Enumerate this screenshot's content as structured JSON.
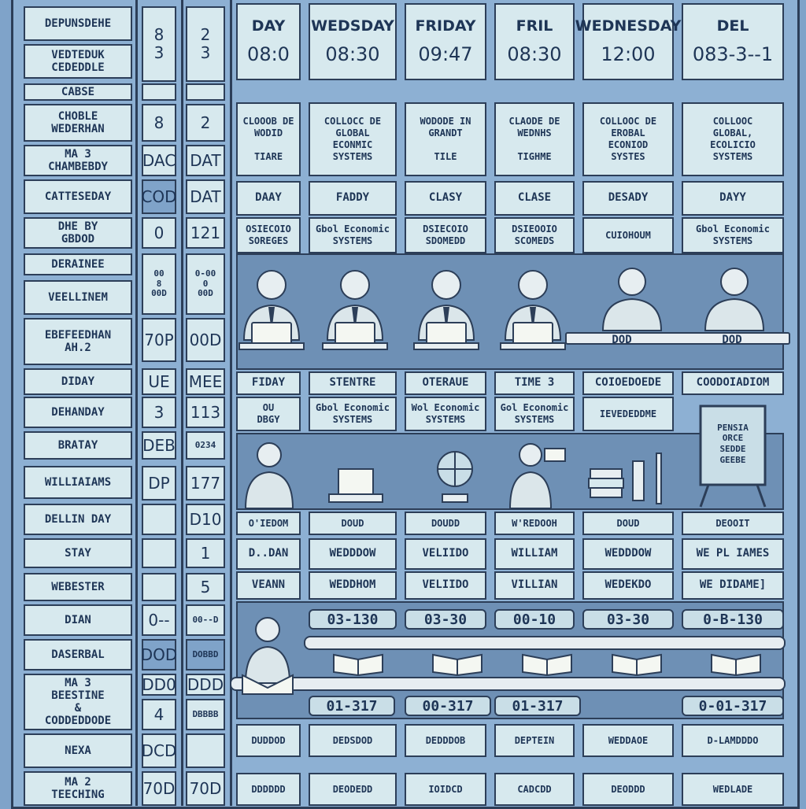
{
  "left_labels": [
    "DEPUNSDEHE",
    "VEDTEDUK\nCEDEDDLE",
    "CABSE",
    "CHOBLE\nWEDERHAN",
    "MA 3\nCHAMBEBDY",
    "CATTESEDAY",
    "DHE BY\nGBDOD",
    "DERAINEE",
    "VEELLINEM",
    "EBEFEEDHAN\nAH.2",
    "DIDAY",
    "DEHANDAY",
    "BRATAY",
    "WILLIAIAMS",
    "DELLIN DAY",
    "STAY",
    "WEBESTER",
    "DIAN",
    "DASERBAL",
    "MA 3\nBEESTINE\n&\nCODDEDDODE",
    "NEXA",
    "MA 2\nTEECHING"
  ],
  "num_col_a": [
    "8\n3",
    "",
    "8",
    "DAC",
    "COD",
    "0",
    "00\n8\n00D",
    "70P",
    "UE",
    "3",
    "DEB",
    "DP",
    "",
    "",
    "",
    "0--",
    "DOD",
    "DD0",
    "4",
    "DCD",
    "70D"
  ],
  "num_col_b": [
    "2\n3",
    "",
    "2",
    "DAT",
    "DAT",
    "121",
    "0-00\n0\n00D",
    "00D",
    "MEE",
    "113",
    "0234",
    "177",
    "D10",
    "1",
    "5",
    "00--D",
    "DOBBD",
    "DDD",
    "DBBBB",
    "",
    "70D"
  ],
  "headers": [
    {
      "day": "DAY",
      "time": "08:0"
    },
    {
      "day": "WEDSDAY",
      "time": "08:30"
    },
    {
      "day": "FRIDAY",
      "time": "09:47"
    },
    {
      "day": "FRIL",
      "time": "08:30"
    },
    {
      "day": "WEDNESDAY",
      "time": "12:00"
    },
    {
      "day": "DEL",
      "time": "083-3--1"
    }
  ],
  "row_courses": [
    "CLOOOB DE\nWODID\n\nTIARE",
    "COLLOCC DE\nGLOBAL\nECONMIC\nSYSTEMS",
    "WODODE IN\nGRANDT\n\nTILE",
    "CLAODE DE\nWEDNHS\n\nTIGHME",
    "COLLOOC DE\nEROBAL\nECONIOD\nSYSTES",
    "COLLOOC\nGLOBAL,\nECOLICIO\nSYSTEMS"
  ],
  "row_days": [
    "DAAY",
    "FADDY",
    "CLASY",
    "CLASE",
    "DESADY",
    "DAYY"
  ],
  "row_systems": [
    "OSIECOIO\nSOREGES",
    "Gbol Economic\nSYSTEMS",
    "DSIECOIO\nSDOMEDD",
    "DSIEOOIO\nSCOMEDS",
    "CUIOHOUM",
    "Gbol Economic\nSYSTEMS"
  ],
  "desk_labels": [
    "DOD",
    "DOD"
  ],
  "row_titles": [
    "FIDAY",
    "STENTRE",
    "OTERAUE",
    "TIME 3",
    "COIOEDOEDE",
    "COODOIADIOM"
  ],
  "row_subs": [
    "OU\nDBGY",
    "Gbol Economic\nSYSTEMS",
    "Wol Economic\nSYSTEMS",
    "Gol Economic\nSYSTEMS",
    "IEVEDEDDME",
    ""
  ],
  "board_text": "PENSIA\nORCE\nSEDDE\nGEEBE",
  "row_names_a": [
    "O'IEDOM",
    "DOUD",
    "DOUDD",
    "W'REDOOH",
    "DOUD",
    "DEOOIT"
  ],
  "row_names_b": [
    "D..DAN",
    "WEDDDOW",
    "VELIIDO",
    "WILLIAM",
    "WEDDDOW",
    "WE PL IAMES"
  ],
  "row_names_c": [
    "VEANN",
    "WEDDHOM",
    "VELIIDO",
    "VILLIAN",
    "WEDEKDO",
    "WE DIDAME]"
  ],
  "row_times_top": [
    "03-130",
    "03-30",
    "00-10",
    "03-30",
    "0-B-130"
  ],
  "row_times_bottom": [
    "01-317",
    "00-317",
    "01-317",
    "0-01-317"
  ],
  "row_foot_a": [
    "DUDDOD",
    "DEDSDOD",
    "DEDDDOB",
    "DEPTEIN",
    "WEDDAOE",
    "D-LAMDDDO"
  ],
  "row_foot_b": [
    "DDDDDD",
    "DEODEDD",
    "IOIDCD",
    "CADCDD",
    "DEODDD",
    "WEDLADE"
  ],
  "colors": {
    "background": "#7fa3c9",
    "cell": "#d7e9ee",
    "line": "#2c3e58",
    "text": "#1e3556"
  },
  "icons": [
    "person-at-laptop-icon",
    "globe-icon",
    "books-icon",
    "open-book-icon",
    "chalkboard-icon"
  ]
}
